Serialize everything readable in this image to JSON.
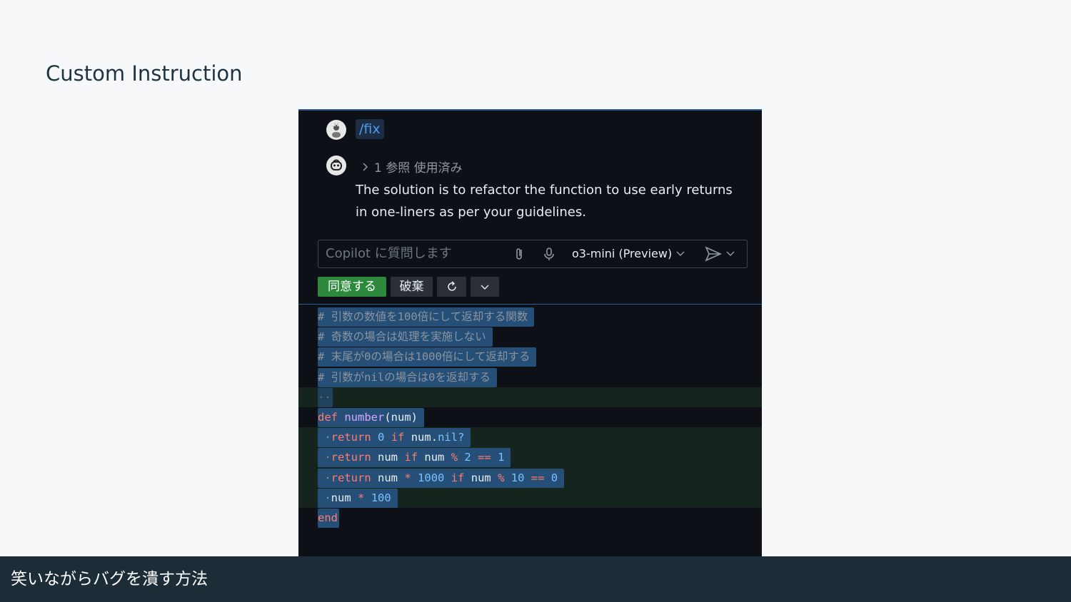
{
  "slide": {
    "title": "Custom Instruction",
    "footer": "笑いながらバグを潰す方法"
  },
  "chat": {
    "command": "/fix",
    "refs": "1 参照 使用済み",
    "answer": "The solution is to refactor the function to use early returns in one-liners as per your guidelines.",
    "input_placeholder": "Copilot に質問します",
    "model": "o3-mini (Preview)",
    "buttons": {
      "accept": "同意する",
      "discard": "破棄"
    }
  },
  "code": {
    "comments": [
      "# 引数の数値を100倍にして返却する関数",
      "# 奇数の場合は処理を実施しない",
      "# 末尾が0の場合は1000倍にして返却する",
      "# 引数がnilの場合は0を返却する"
    ],
    "blank_marker": "··",
    "def_kw": "def",
    "fn_name": "number",
    "param": "(num)",
    "indent": " ·",
    "kw_return": "return",
    "kw_if": "if",
    "id_num": "num",
    "method_nil": "nil?",
    "dot": ".",
    "num_0": "0",
    "num_1": "1",
    "num_2": "2",
    "num_10": "10",
    "num_100": "100",
    "num_1000": "1000",
    "op_mod": "%",
    "op_eq": "==",
    "op_mul": "*",
    "end_kw": "end"
  },
  "colors": {
    "accept": "#2d8a3c",
    "selection": "#264f78",
    "added_line": "#15241d",
    "link_blue": "#4f9cf0"
  },
  "icons": [
    "user-avatar-icon",
    "copilot-icon",
    "chevron-right-icon",
    "paperclip-icon",
    "microphone-icon",
    "chevron-down-icon",
    "send-icon",
    "redo-icon"
  ]
}
